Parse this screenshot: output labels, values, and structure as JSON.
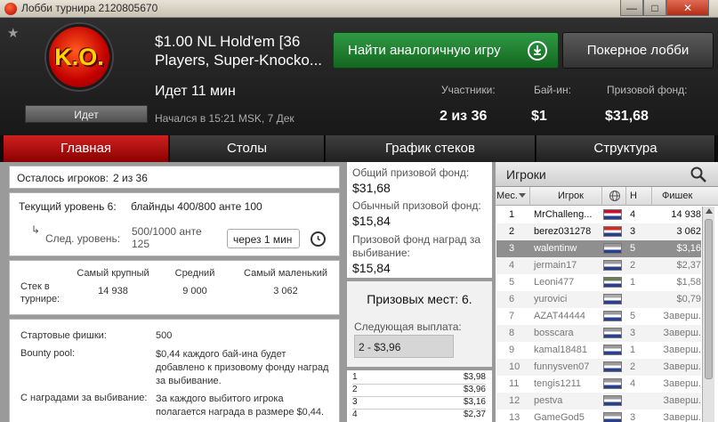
{
  "window": {
    "title": "Лобби турнира 2120805670",
    "minimize": "—",
    "maximize": "□",
    "close": "✕"
  },
  "header": {
    "status": "Идет",
    "logo_text": "K.O.",
    "game_title": "$1.00 NL Hold'em [36 Players, Super-Knocko...",
    "find_similar": "Найти аналогичную игру",
    "poker_lobby": "Покерное лобби",
    "running": "Идет 11 мин",
    "started": "Начался в 15:21 MSK, 7 Дек",
    "participants_label": "Участники:",
    "participants_value": "2 из 36",
    "buyin_label": "Бай-ин:",
    "buyin_value": "$1",
    "prize_label": "Призовой фонд:",
    "prize_value": "$31,68"
  },
  "tabs": [
    "Главная",
    "Столы",
    "График стеков",
    "Структура"
  ],
  "main": {
    "players_left_label": "Осталось игроков:",
    "players_left_value": "2 из 36",
    "current_level_label": "Текущий уровень 6:",
    "current_level_value": "блайнды 400/800 анте 100",
    "next_level_label": "След. уровень:",
    "next_level_value": "500/1000 анте 125",
    "next_level_time": "через 1 мин",
    "stack_label": "Стек в турнире:",
    "stack_headers": [
      "Самый крупный",
      "Средний",
      "Самый маленький"
    ],
    "stack_values": [
      "14 938",
      "9 000",
      "3 062"
    ],
    "start_chips_label": "Стартовые фишки:",
    "start_chips_value": "500",
    "bounty_label": "Bounty pool:",
    "bounty_value": "$0,44 каждого бай-ина будет добавлено к призовому фонду наград за выбивание.",
    "ko_label": "С наградами за выбивание:",
    "ko_value": "За каждого выбитого игрока полагается награда в размере $0,44."
  },
  "prize": {
    "total_label": "Общий призовой фонд:",
    "total_value": "$31,68",
    "regular_label": "Обычный призовой фонд:",
    "regular_value": "$15,84",
    "ko_label": "Призовой фонд наград за выбивание:",
    "ko_value": "$15,84",
    "places": "Призовых мест: 6.",
    "next_payout_label": "Следующая выплата:",
    "next_payout_value": "2 - $3,96",
    "payouts": [
      {
        "place": "1",
        "amount": "$3,98"
      },
      {
        "place": "2",
        "amount": "$3,96"
      },
      {
        "place": "3",
        "amount": "$3,16"
      },
      {
        "place": "4",
        "amount": "$2,37"
      }
    ]
  },
  "players": {
    "title": "Игроки",
    "search_icon": "magnifier-icon",
    "columns": [
      "Мес.",
      "Игрок",
      "Н",
      "Фишек"
    ],
    "rows": [
      {
        "place": "1",
        "name": "MrChalleng...",
        "n": "4",
        "chips": "14 938",
        "active": true,
        "flag": "#c8102e"
      },
      {
        "place": "2",
        "name": "berez031278",
        "n": "3",
        "chips": "3 062",
        "active": true,
        "flag": "#d52b1e"
      },
      {
        "place": "3",
        "name": "walentinw",
        "n": "5",
        "chips": "$3,16",
        "active": false,
        "flag": "#999999"
      },
      {
        "place": "4",
        "name": "jermain17",
        "n": "2",
        "chips": "$2,37",
        "active": false,
        "flag": "#999999"
      },
      {
        "place": "5",
        "name": "Leoni477",
        "n": "1",
        "chips": "$1,58",
        "active": false,
        "flag": "#6a7d5a"
      },
      {
        "place": "6",
        "name": "yurovici",
        "n": "",
        "chips": "$0,79",
        "active": false,
        "flag": "#aaaaaa"
      },
      {
        "place": "7",
        "name": "AZAT44444",
        "n": "5",
        "chips": "Заверш.",
        "active": false,
        "flag": "#999999"
      },
      {
        "place": "8",
        "name": "bosscara",
        "n": "3",
        "chips": "Заверш.",
        "active": false,
        "flag": "#999999"
      },
      {
        "place": "9",
        "name": "kamal18481",
        "n": "1",
        "chips": "Заверш.",
        "active": false,
        "flag": "#999999"
      },
      {
        "place": "10",
        "name": "funnysven07",
        "n": "2",
        "chips": "Заверш.",
        "active": false,
        "flag": "#999999"
      },
      {
        "place": "11",
        "name": "tengis1211",
        "n": "4",
        "chips": "Заверш.",
        "active": false,
        "flag": "#999999"
      },
      {
        "place": "12",
        "name": "pestva",
        "n": "",
        "chips": "Заверш.",
        "active": false,
        "flag": "#999999"
      },
      {
        "place": "13",
        "name": "GameGod5",
        "n": "3",
        "chips": "Заверш.",
        "active": false,
        "flag": "#999999"
      }
    ]
  }
}
